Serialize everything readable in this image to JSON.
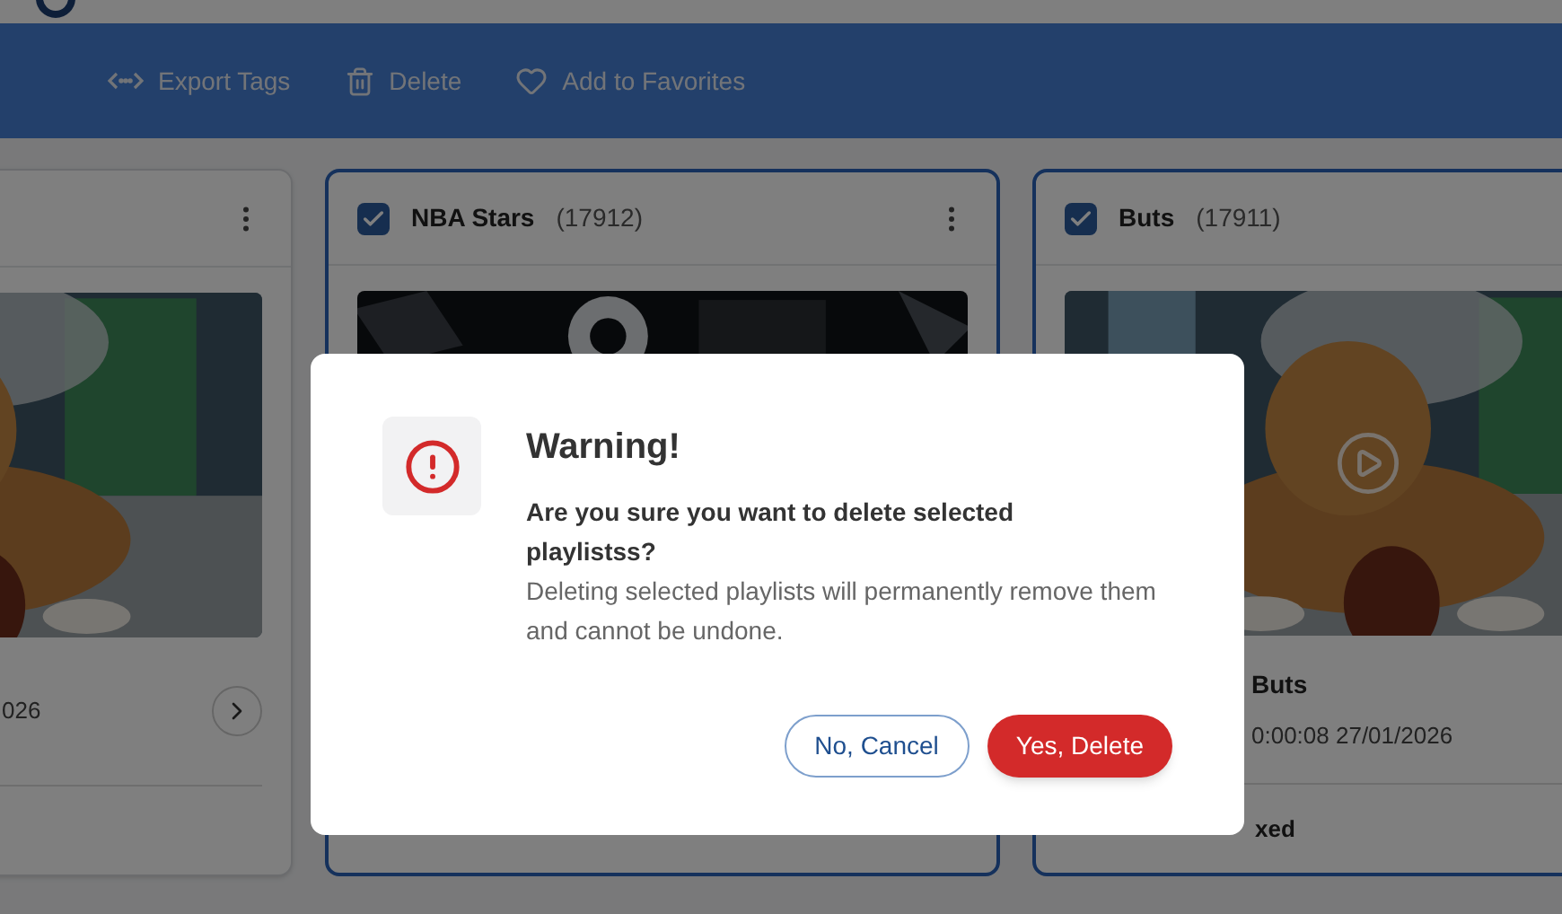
{
  "toolbar": {
    "actions": [
      {
        "kind": "export",
        "label": "Export Tags"
      },
      {
        "kind": "delete",
        "label": "Delete"
      },
      {
        "kind": "favorite",
        "label": "Add to Favorites"
      }
    ]
  },
  "cards": [
    {
      "selected": false,
      "date": "026"
    },
    {
      "selected": true,
      "title": "NBA Stars",
      "count": "(17912)"
    },
    {
      "selected": true,
      "title": "Buts",
      "count": "(17911)",
      "name": "Buts",
      "date": "0:00:08 27/01/2026",
      "type": "xed"
    }
  ],
  "dialog": {
    "title": "Warning!",
    "question": "Are you sure you want to delete selected playlistss?",
    "message": "Deleting selected playlists will permanently remove them and cannot be undone.",
    "buttons": [
      {
        "kind": "cancel",
        "label": "No, Cancel"
      },
      {
        "kind": "confirm",
        "label": "Yes, Delete"
      }
    ]
  }
}
